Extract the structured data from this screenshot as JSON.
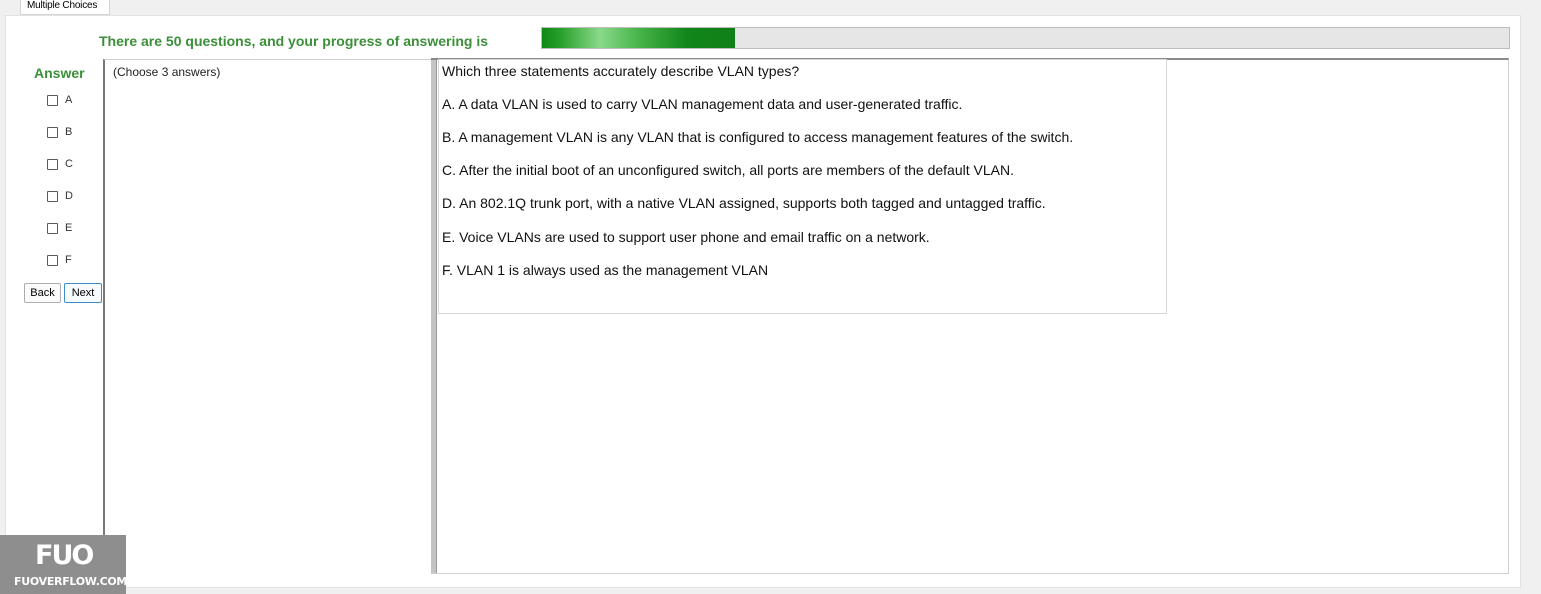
{
  "tab": {
    "label": "Multiple Choices"
  },
  "progress": {
    "label": "There are 50 questions, and your progress of answering is",
    "fraction": 0.2
  },
  "answer": {
    "label": "Answer",
    "options": [
      {
        "label": "A",
        "checked": false
      },
      {
        "label": "B",
        "checked": false
      },
      {
        "label": "C",
        "checked": false
      },
      {
        "label": "D",
        "checked": false
      },
      {
        "label": "E",
        "checked": false
      },
      {
        "label": "F",
        "checked": false
      }
    ]
  },
  "nav": {
    "back_label": "Back",
    "next_label": "Next"
  },
  "instructions": {
    "text": "(Choose 3 answers)"
  },
  "question": {
    "title": "Which three statements accurately describe VLAN types?",
    "choices": [
      "A.  A data VLAN is used to carry VLAN management data and user-generated traffic.",
      "B.  A management VLAN is any VLAN that is configured to access management features of the switch.",
      "C.  After the initial boot of an unconfigured switch, all ports are members of the default VLAN.",
      "D.  An 802.1Q trunk port, with a native VLAN assigned, supports both tagged and untagged traffic.",
      "E.  Voice VLANs are used to support user phone and email traffic on a network.",
      "F.  VLAN 1 is always used as the management VLAN"
    ]
  },
  "watermark": {
    "logo": "FUO",
    "text": "FUOVERFLOW.COM"
  },
  "colors": {
    "accent_green": "#3b8f38",
    "progress_green": "#0f8a14"
  }
}
